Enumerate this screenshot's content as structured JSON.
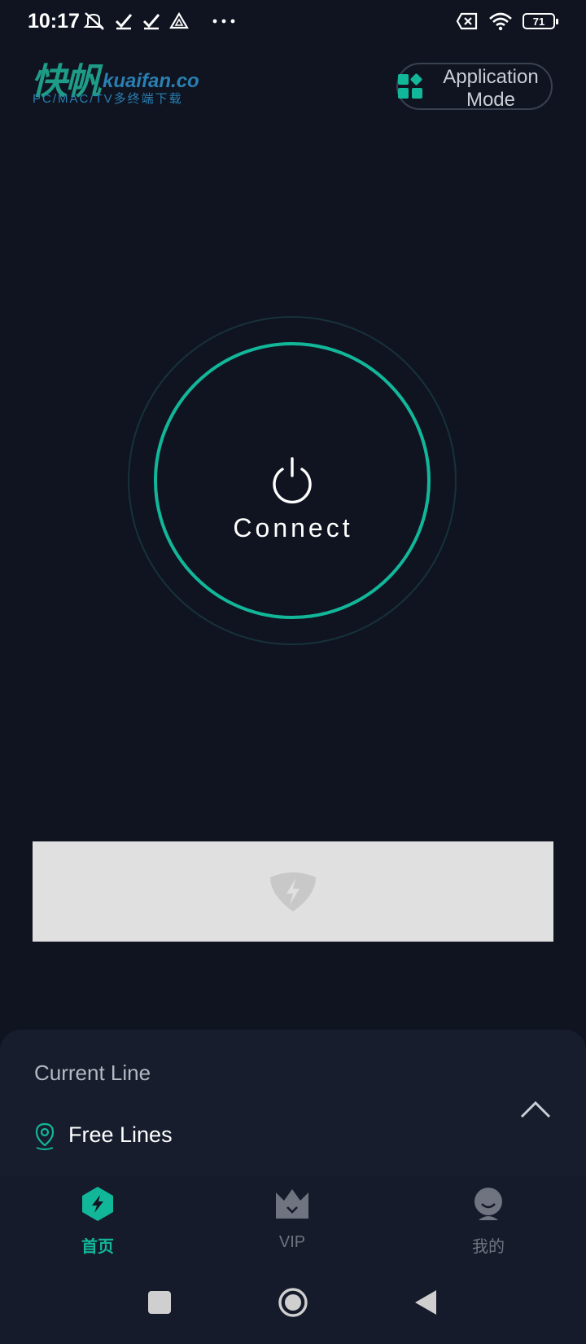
{
  "status_bar": {
    "time": "10:17",
    "battery": "71",
    "icons_left": [
      "mute-icon",
      "check-icon",
      "check-icon",
      "drive-icon",
      "more-dots-icon"
    ],
    "icons_right": [
      "no-sim-icon",
      "wifi-icon",
      "battery-icon"
    ]
  },
  "header": {
    "logo_cn": "快帆",
    "logo_domain": "kuaifan.co",
    "logo_sub": "PC/MAC/TV多终端下载",
    "mode_button_line1": "Application",
    "mode_button_line2": "Mode"
  },
  "connect": {
    "label": "Connect"
  },
  "current_line": {
    "title": "Current Line",
    "value": "Free Lines"
  },
  "tabs": [
    {
      "label": "首页",
      "icon": "bolt-hexagon-icon",
      "active": true
    },
    {
      "label": "VIP",
      "icon": "crown-icon",
      "active": false
    },
    {
      "label": "我的",
      "icon": "profile-icon",
      "active": false
    }
  ],
  "colors": {
    "background": "#0f1420",
    "accent": "#12b79a",
    "panel": "#171d2d",
    "tab_inactive": "#6f7480"
  }
}
